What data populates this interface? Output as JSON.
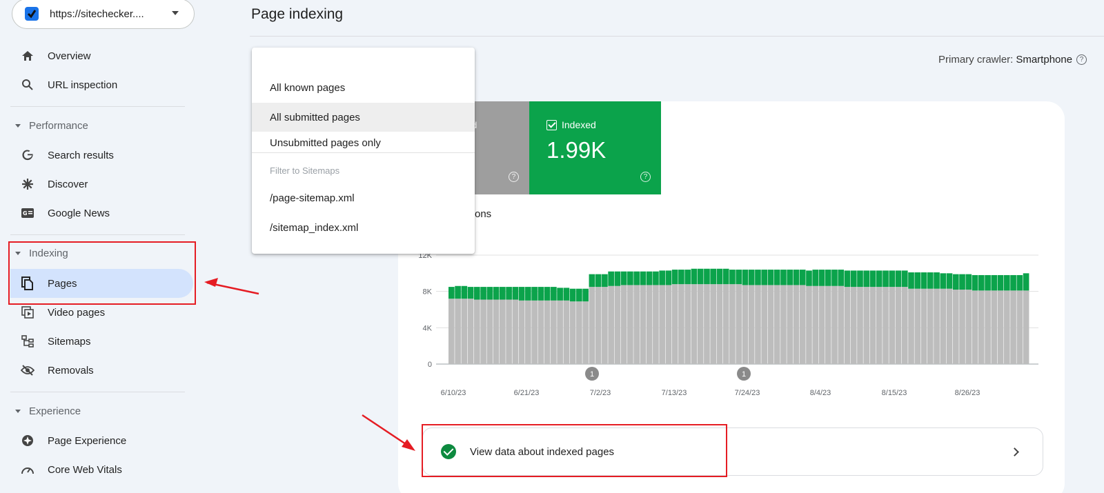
{
  "property": {
    "url": "https://sitechecker...."
  },
  "sidebar": {
    "overview": "Overview",
    "url_inspection": "URL inspection",
    "performance": "Performance",
    "search_results": "Search results",
    "discover": "Discover",
    "google_news": "Google News",
    "indexing": "Indexing",
    "pages": "Pages",
    "video_pages": "Video pages",
    "sitemaps": "Sitemaps",
    "removals": "Removals",
    "experience": "Experience",
    "page_experience": "Page Experience",
    "core_web_vitals": "Core Web Vitals"
  },
  "main": {
    "title": "Page indexing",
    "crawler_label": "Primary crawler:",
    "crawler_value": "Smartphone",
    "tile_gray_label_fragment": "d",
    "tile_indexed_label": "Indexed",
    "tile_indexed_value": "1.99K",
    "impressions_fragment": "ons",
    "view_data": "View data about indexed pages"
  },
  "dropdown": {
    "items": [
      "All known pages",
      "All submitted pages",
      "Unsubmitted pages only"
    ],
    "heading": "Filter to Sitemaps",
    "sitemaps": [
      "/page-sitemap.xml",
      "/sitemap_index.xml"
    ]
  },
  "colors": {
    "indexed": "#0ba34b",
    "not_indexed": "#bdbdbd",
    "active_nav": "#d3e3fd",
    "annotation": "#e51c23"
  },
  "chart_data": {
    "type": "bar",
    "stacked": true,
    "yticks": [
      "12K",
      "8K",
      "4K",
      "0"
    ],
    "ylim": [
      0,
      12000
    ],
    "xticks": [
      "6/10/23",
      "6/21/23",
      "7/2/23",
      "7/13/23",
      "7/24/23",
      "8/4/23",
      "8/15/23",
      "8/26/23"
    ],
    "markers": [
      {
        "label": "1",
        "date": "7/2/23"
      },
      {
        "label": "1",
        "date": "7/24/23"
      }
    ],
    "series": [
      {
        "name": "Not indexed",
        "color": "#bdbdbd",
        "values": [
          7200,
          7200,
          7200,
          7200,
          7100,
          7100,
          7100,
          7100,
          7100,
          7100,
          7100,
          7000,
          7000,
          7000,
          7000,
          7000,
          7000,
          7000,
          7000,
          6900,
          6900,
          6900,
          8500,
          8500,
          8500,
          8600,
          8600,
          8700,
          8700,
          8700,
          8700,
          8700,
          8700,
          8700,
          8700,
          8800,
          8800,
          8800,
          8800,
          8800,
          8800,
          8800,
          8800,
          8800,
          8800,
          8800,
          8700,
          8700,
          8700,
          8700,
          8700,
          8700,
          8700,
          8700,
          8700,
          8700,
          8600,
          8600,
          8600,
          8600,
          8600,
          8600,
          8500,
          8500,
          8500,
          8500,
          8500,
          8500,
          8500,
          8500,
          8500,
          8500,
          8300,
          8300,
          8300,
          8300,
          8300,
          8300,
          8300,
          8200,
          8200,
          8200,
          8100,
          8100,
          8100,
          8100,
          8100,
          8100,
          8100,
          8100,
          8100
        ]
      },
      {
        "name": "Indexed",
        "color": "#0ba34b",
        "values": [
          1300,
          1400,
          1400,
          1300,
          1400,
          1400,
          1400,
          1400,
          1400,
          1400,
          1400,
          1500,
          1500,
          1500,
          1500,
          1500,
          1500,
          1400,
          1400,
          1400,
          1400,
          1400,
          1400,
          1400,
          1400,
          1600,
          1600,
          1500,
          1500,
          1500,
          1500,
          1500,
          1500,
          1600,
          1600,
          1600,
          1600,
          1600,
          1700,
          1700,
          1700,
          1700,
          1700,
          1700,
          1600,
          1600,
          1700,
          1700,
          1700,
          1700,
          1700,
          1700,
          1700,
          1700,
          1700,
          1700,
          1700,
          1800,
          1800,
          1800,
          1800,
          1800,
          1800,
          1800,
          1800,
          1800,
          1800,
          1800,
          1800,
          1800,
          1800,
          1800,
          1800,
          1800,
          1800,
          1800,
          1800,
          1700,
          1700,
          1700,
          1700,
          1700,
          1700,
          1700,
          1700,
          1700,
          1700,
          1700,
          1700,
          1700,
          1900
        ]
      }
    ]
  }
}
